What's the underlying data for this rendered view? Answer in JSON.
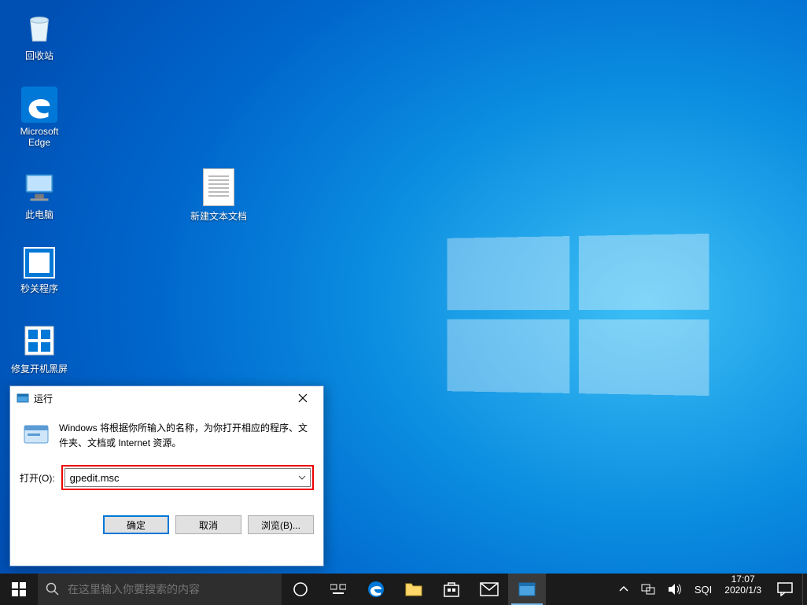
{
  "desktop": {
    "icons": {
      "recycle_bin": "回收站",
      "edge": "Microsoft\nEdge",
      "this_pc": "此电脑",
      "text_doc": "新建文本文档",
      "sec_close": "秒关程序",
      "repair_boot": "修复开机黑屏"
    }
  },
  "run_dialog": {
    "title": "运行",
    "description": "Windows 将根据你所输入的名称，为你打开相应的程序、文件夹、文档或 Internet 资源。",
    "open_label": "打开(O):",
    "input_value": "gpedit.msc",
    "ok_button": "确定",
    "cancel_button": "取消",
    "browse_button": "浏览(B)..."
  },
  "taskbar": {
    "search_placeholder": "在这里输入你要搜索的内容",
    "ime_label": "SQI",
    "time": "17:07",
    "date": "2020/1/3"
  }
}
